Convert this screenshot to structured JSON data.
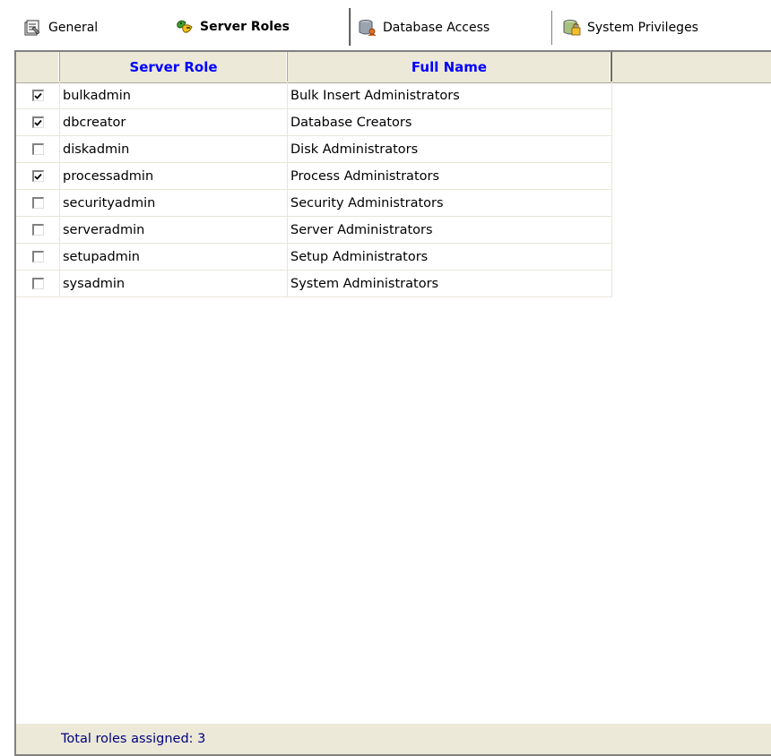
{
  "tabs": [
    {
      "label": "General",
      "icon": "properties-icon",
      "selected": false
    },
    {
      "label": "Server Roles",
      "icon": "server-roles-icon",
      "selected": true
    },
    {
      "label": "Database Access",
      "icon": "database-access-icon",
      "selected": false
    },
    {
      "label": "System Privileges",
      "icon": "system-privileges-icon",
      "selected": false
    }
  ],
  "grid": {
    "columns": {
      "server_role": "Server Role",
      "full_name": "Full Name"
    },
    "rows": [
      {
        "checked": true,
        "role": "bulkadmin",
        "full_name": "Bulk Insert Administrators"
      },
      {
        "checked": true,
        "role": "dbcreator",
        "full_name": "Database Creators"
      },
      {
        "checked": false,
        "role": "diskadmin",
        "full_name": "Disk Administrators"
      },
      {
        "checked": true,
        "role": "processadmin",
        "full_name": "Process Administrators"
      },
      {
        "checked": false,
        "role": "securityadmin",
        "full_name": "Security Administrators"
      },
      {
        "checked": false,
        "role": "serveradmin",
        "full_name": "Server Administrators"
      },
      {
        "checked": false,
        "role": "setupadmin",
        "full_name": "Setup Administrators"
      },
      {
        "checked": false,
        "role": "sysadmin",
        "full_name": "System Administrators"
      }
    ]
  },
  "footer": {
    "status": "Total roles assigned: 3"
  },
  "colors": {
    "header_text": "#0000ff",
    "footer_text": "#000080",
    "panel_bg": "#ece9d8"
  }
}
